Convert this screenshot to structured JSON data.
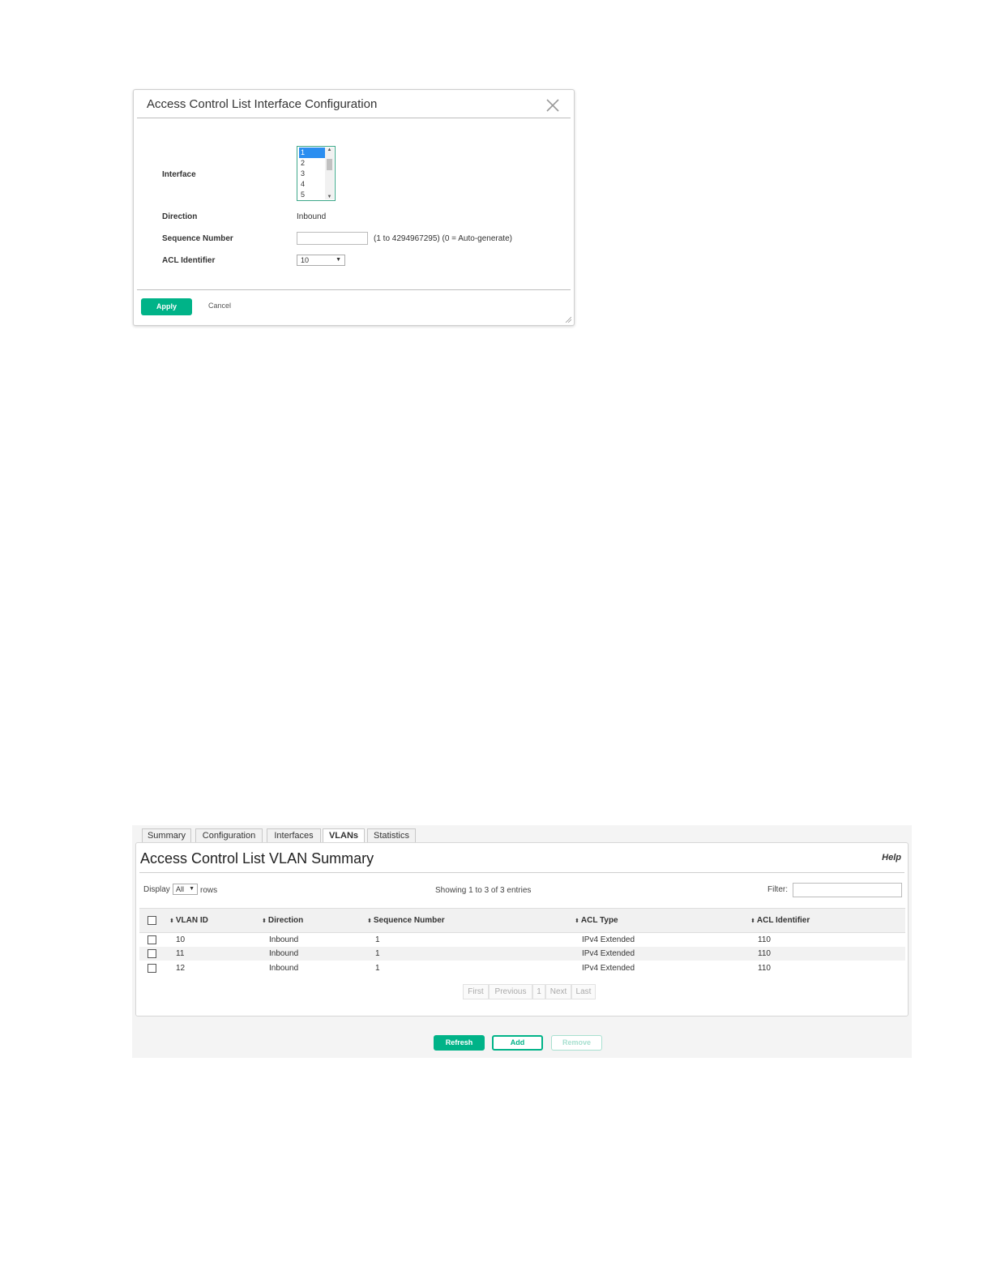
{
  "dialog": {
    "title": "Access Control List Interface Configuration",
    "close_icon": "close-icon",
    "interface_label": "Interface",
    "interface_options": [
      "1",
      "2",
      "3",
      "4",
      "5"
    ],
    "interface_selected": "1",
    "direction_label": "Direction",
    "direction_value": "Inbound",
    "sequence_label": "Sequence Number",
    "sequence_value": "",
    "sequence_hint": "(1 to 4294967295) (0 = Auto-generate)",
    "acl_label": "ACL Identifier",
    "acl_value": "10",
    "apply_label": "Apply",
    "cancel_label": "Cancel"
  },
  "summary": {
    "tabs": [
      "Summary",
      "Configuration",
      "Interfaces",
      "VLANs",
      "Statistics"
    ],
    "active_tab": "VLANs",
    "title": "Access Control List VLAN Summary",
    "help_label": "Help",
    "display_label": "Display",
    "display_value": "All",
    "rows_label": "rows",
    "showing_text": "Showing 1 to 3 of 3 entries",
    "filter_label": "Filter:",
    "filter_value": "",
    "columns": [
      "VLAN ID",
      "Direction",
      "Sequence Number",
      "ACL Type",
      "ACL Identifier"
    ],
    "rows": [
      {
        "vlan_id": "10",
        "direction": "Inbound",
        "sequence": "1",
        "acl_type": "IPv4 Extended",
        "acl_id": "110"
      },
      {
        "vlan_id": "11",
        "direction": "Inbound",
        "sequence": "1",
        "acl_type": "IPv4 Extended",
        "acl_id": "110"
      },
      {
        "vlan_id": "12",
        "direction": "Inbound",
        "sequence": "1",
        "acl_type": "IPv4 Extended",
        "acl_id": "110"
      }
    ],
    "pagination": [
      "First",
      "Previous",
      "1",
      "Next",
      "Last"
    ],
    "refresh_label": "Refresh",
    "add_label": "Add",
    "remove_label": "Remove"
  },
  "colors": {
    "accent": "#00b388",
    "selection": "#2b8ef0"
  }
}
